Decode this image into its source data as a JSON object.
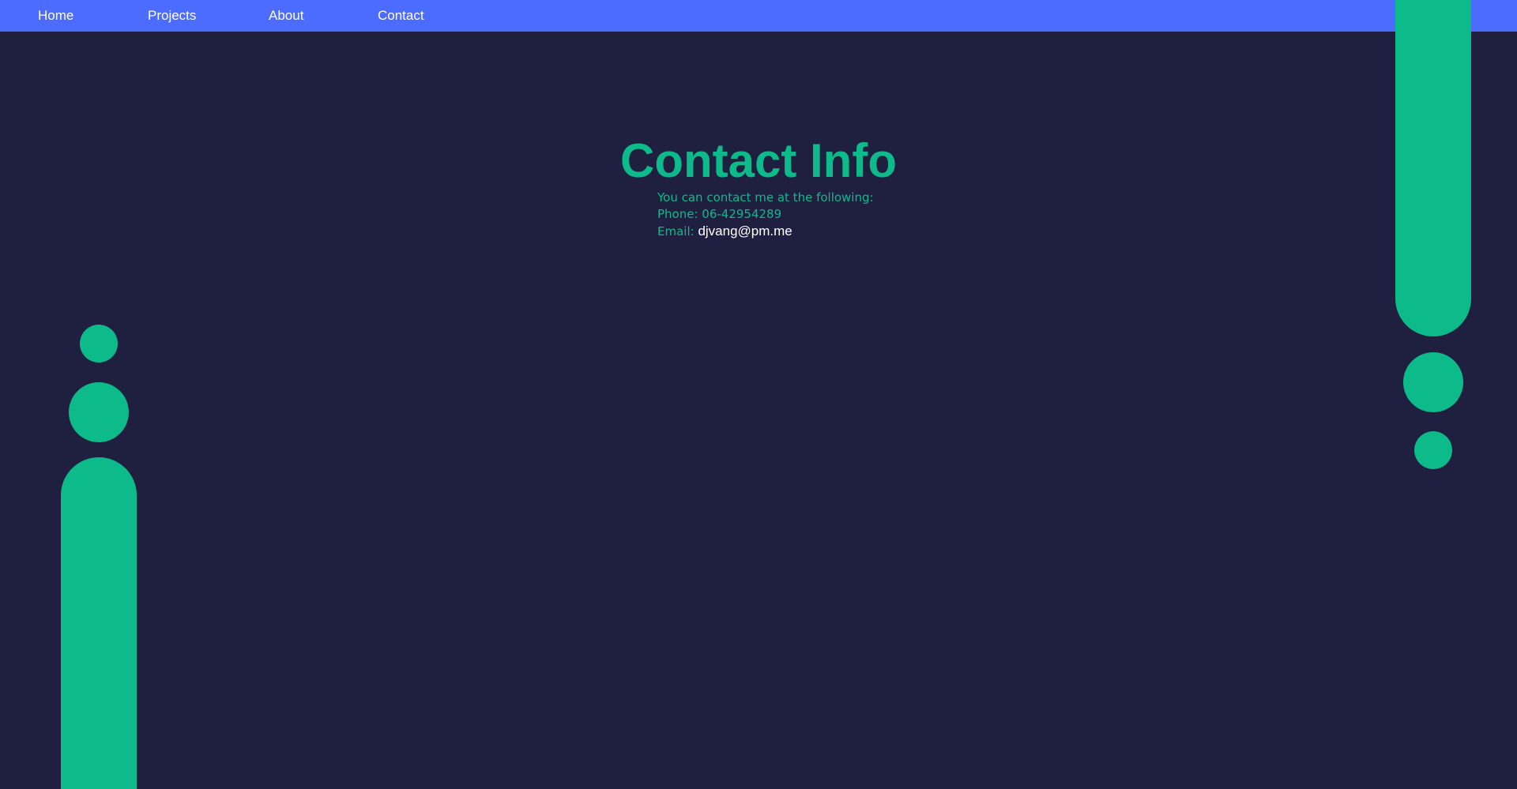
{
  "nav": {
    "home": "Home",
    "projects": "Projects",
    "about": "About",
    "contact": "Contact"
  },
  "contact": {
    "title": "Contact Info",
    "intro": "You can contact me at the following:",
    "phone_label": "Phone: 06-42954289",
    "email_label": "Email:",
    "email_value": "djvang@pm.me"
  },
  "colors": {
    "background": "#1f1f40",
    "nav_bar": "#4c6bff",
    "accent": "#0cbb89",
    "nav_text": "#ffffff"
  }
}
